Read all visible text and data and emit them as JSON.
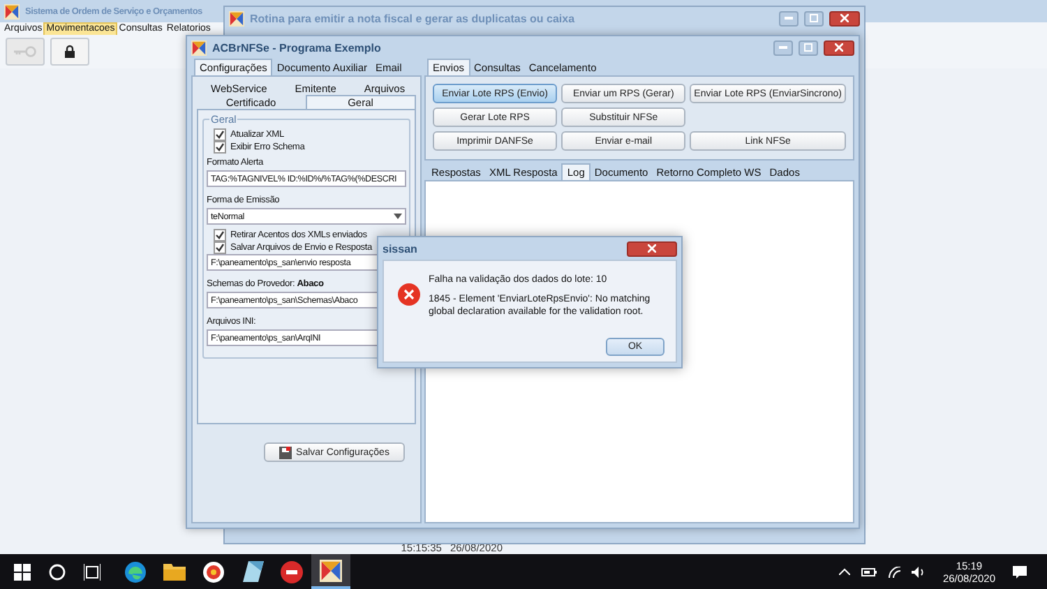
{
  "main_window": {
    "title": "Sistema de Ordem de Serviço e Orçamentos",
    "menu": [
      {
        "label": "Arquivos",
        "selected": false
      },
      {
        "label": "Movimentacoes",
        "selected": true
      },
      {
        "label": "Consultas",
        "selected": false
      },
      {
        "label": "Relatorios",
        "selected": false
      }
    ],
    "toolbar": [
      {
        "kind": "key",
        "disabled": true
      },
      {
        "kind": "lock",
        "disabled": false
      }
    ],
    "status_bar": [
      "15:15:35",
      "26/08/2020"
    ]
  },
  "rotina_window": {
    "title": "Rotina para emitir a nota fiscal e gerar as duplicatas ou caixa"
  },
  "acbr_window": {
    "title": "ACBrNFSe - Programa Exemplo",
    "left_tabs": [
      {
        "label": "Configurações",
        "selected": true
      },
      {
        "label": "Documento Auxiliar",
        "selected": false
      },
      {
        "label": "Email",
        "selected": false
      }
    ],
    "config_tabs_back": [
      {
        "label": "WebService",
        "selected": false
      },
      {
        "label": "Emitente",
        "selected": false
      },
      {
        "label": "Arquivos",
        "selected": false
      }
    ],
    "config_tabs_front": [
      {
        "label": "Certificado",
        "selected": false
      },
      {
        "label": "Geral",
        "selected": true
      }
    ],
    "group": {
      "title": "Geral",
      "items": [
        {
          "kind": "checkbox",
          "label": "Atualizar XML",
          "checked": true
        },
        {
          "kind": "checkbox",
          "label": "Exibir Erro Schema",
          "checked": true
        },
        {
          "kind": "label",
          "text": "Formato Alerta"
        },
        {
          "kind": "input",
          "value": "TAG:%TAGNIVEL% ID:%ID%/%TAG%(%DESCRI"
        },
        {
          "kind": "label",
          "text": "Forma de Emissão"
        },
        {
          "kind": "select",
          "value": "teNormal"
        },
        {
          "kind": "checkbox",
          "label": "Retirar Acentos dos XMLs enviados",
          "checked": true
        },
        {
          "kind": "checkbox",
          "label": "Salvar Arquivos de Envio e Resposta",
          "checked": true
        },
        {
          "kind": "input",
          "value": "F:\\paneamento\\ps_san\\envio resposta"
        },
        {
          "kind": "label",
          "text": "Schemas do Provedor: **Abaco**"
        },
        {
          "kind": "input",
          "value": "F:\\paneamento\\ps_san\\Schemas\\Abaco"
        },
        {
          "kind": "label",
          "text": "Arquivos INI:"
        },
        {
          "kind": "input",
          "value": "F:\\paneamento\\ps_san\\ArqINI"
        }
      ]
    },
    "save_button": "Salvar Configurações",
    "right_tabs": [
      {
        "label": "Envios",
        "selected": true
      },
      {
        "label": "Consultas",
        "selected": false
      },
      {
        "label": "Cancelamento",
        "selected": false
      }
    ],
    "action_rows": [
      [
        {
          "label": "Enviar Lote RPS (Envio)",
          "selected": true
        },
        {
          "label": "Enviar um RPS (Gerar)",
          "selected": false
        },
        {
          "label": "Enviar Lote RPS (EnviarSincrono)",
          "selected": false
        }
      ],
      [
        {
          "label": "Gerar Lote RPS",
          "selected": false
        },
        {
          "label": "Substituir NFSe",
          "selected": false
        }
      ],
      [
        {
          "label": "Imprimir DANFSe",
          "selected": false
        },
        {
          "label": "Enviar e-mail",
          "selected": false
        },
        {
          "label": "Link NFSe",
          "selected": false
        }
      ]
    ],
    "result_tabs": [
      {
        "label": "Respostas",
        "selected": false
      },
      {
        "label": "XML Resposta",
        "selected": false
      },
      {
        "label": "Log",
        "selected": true
      },
      {
        "label": "Documento",
        "selected": false
      },
      {
        "label": "Retorno Completo WS",
        "selected": false
      },
      {
        "label": "Dados",
        "selected": false
      }
    ]
  },
  "dialog": {
    "title": "sissan",
    "heading": "Falha na validação dos dados do lote: 10",
    "message": "1845 - Element 'EnviarLoteRpsEnvio': No matching global declaration available for the validation root.",
    "ok": "OK"
  },
  "taskbar": {
    "apps": [
      {
        "kind": "edge",
        "active": false
      },
      {
        "kind": "folder",
        "active": false
      },
      {
        "kind": "browser",
        "active": false
      },
      {
        "kind": "notes",
        "active": false
      },
      {
        "kind": "dx",
        "active": false
      },
      {
        "kind": "app",
        "active": true
      }
    ],
    "time": "15:19",
    "date": "26/08/2020"
  }
}
